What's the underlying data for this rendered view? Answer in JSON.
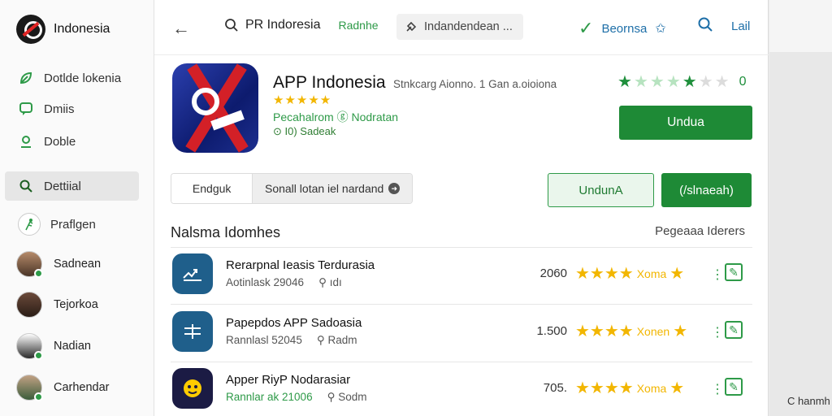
{
  "sidebar": {
    "brand": "Indonesia",
    "nav": [
      {
        "label": "Dotlde lokenia",
        "icon": "leaf-icon"
      },
      {
        "label": "Dmiis",
        "icon": "chat-icon"
      },
      {
        "label": "Doble",
        "icon": "pin-icon"
      },
      {
        "label": "Dettiial",
        "icon": "search-icon"
      },
      {
        "label": "Praflgen",
        "icon": "runner-icon"
      }
    ],
    "people": [
      {
        "name": "Sadnean"
      },
      {
        "name": "Tejorkoa"
      },
      {
        "name": "Nadian"
      },
      {
        "name": "Carhendar"
      }
    ]
  },
  "topbar": {
    "search_query": "PR Indoresia",
    "search_sub": "Radnhe",
    "chip": "Indandendean ...",
    "right_label": "Beornsa",
    "fav_label": "Lail"
  },
  "app": {
    "name": "APP Indonesia",
    "meta": "Stnkcarg Aionno. 1 Gan a.oioiona",
    "stars": "★★★★★",
    "developer": "Pecahalrom ⓖ Nodratan",
    "install_note": "⊙ I0) Sadeak",
    "rating_value": "0",
    "install_button": "Undua",
    "rating_stars": [
      {
        "glyph": "★",
        "state": "full"
      },
      {
        "glyph": "★",
        "state": "light"
      },
      {
        "glyph": "★",
        "state": "light"
      },
      {
        "glyph": "★",
        "state": "light"
      },
      {
        "glyph": "★",
        "state": "full"
      },
      {
        "glyph": "★",
        "state": "grey"
      },
      {
        "glyph": "★",
        "state": "grey"
      }
    ]
  },
  "tabs": [
    "Endguk",
    "Sonall lotan iel nardand"
  ],
  "actions": {
    "outline_button": "UndunA",
    "solid_button": "(/slnaeah)"
  },
  "section": {
    "title": "Nalsma Idomhes",
    "link": "Pegeaaa Iderers"
  },
  "list": [
    {
      "title": "Rerarpnal Ieasis Terdurasia",
      "sub1": "Aotinlask 29046",
      "sub2": "ıdı",
      "count": "2060",
      "star_label": "Xoma"
    },
    {
      "title": "Papepdos APP Sadoasia",
      "sub1": "Rannlasl 52045",
      "sub2": "Radm",
      "count": "1.500",
      "star_label": "Xonen"
    },
    {
      "title": "Apper RiyP Nodarasiar",
      "sub1": "Rannlar ak 21006",
      "sub2": "Sodm",
      "count": "705.",
      "star_label": "Xoma"
    }
  ],
  "footer": "C hanmh",
  "colors": {
    "accent_green": "#1e8a36",
    "link_blue": "#1e6fa8",
    "star_gold": "#f2b600"
  }
}
